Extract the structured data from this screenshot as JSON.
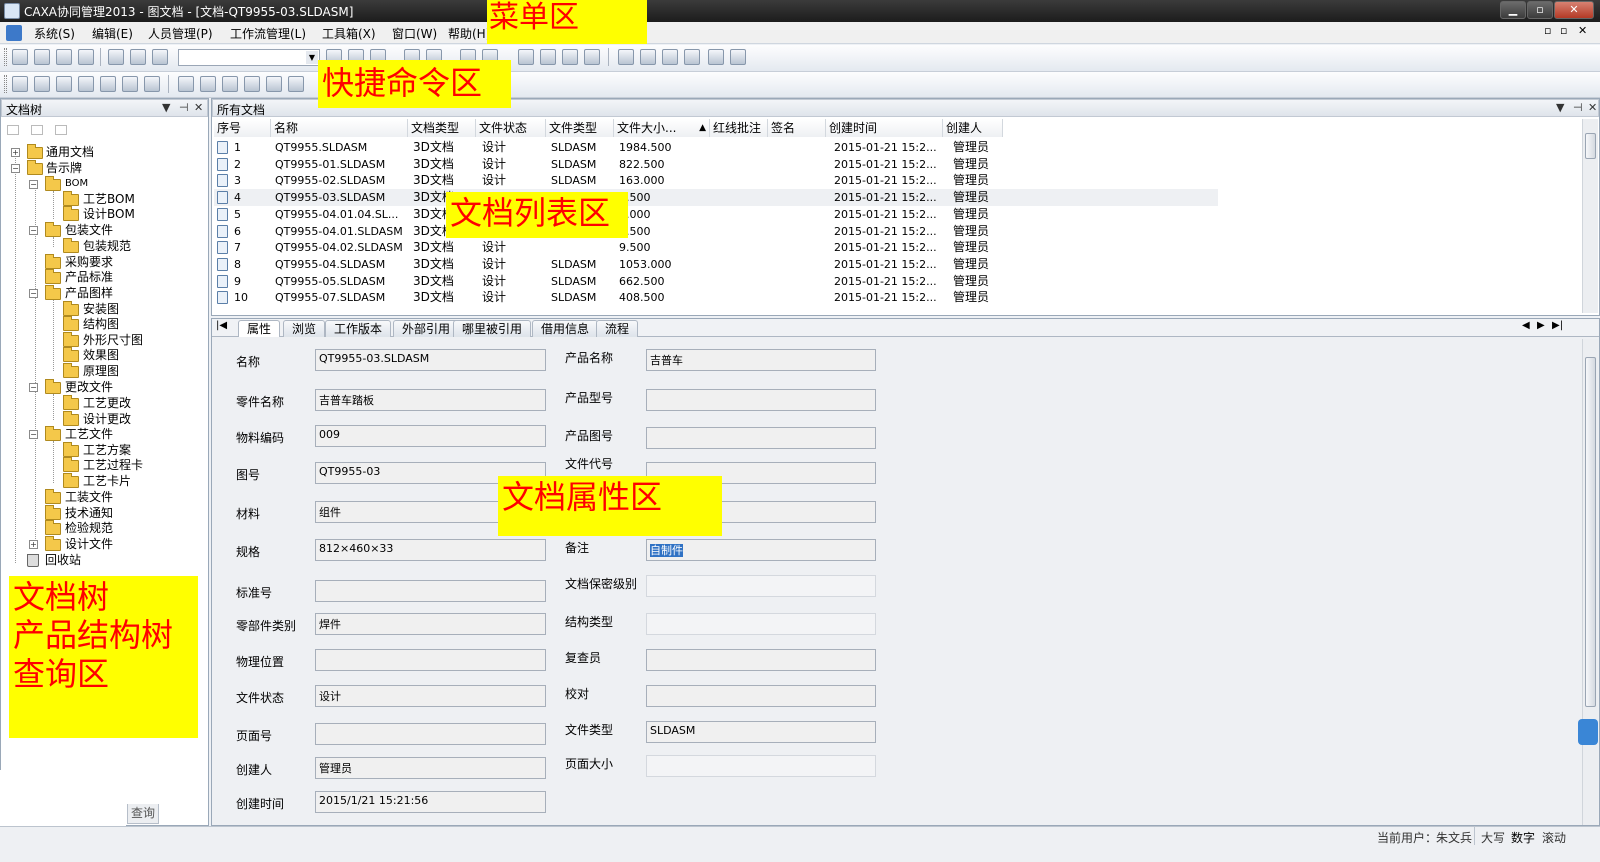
{
  "window": {
    "title": "CAXA协同管理2013 - 图文档 - [文档-QT9955-03.SLDASM]",
    "min": "▁",
    "max": "▫",
    "close": "✕"
  },
  "menu": {
    "items": [
      "系统(S)",
      "编辑(E)",
      "人员管理(P)",
      "工作流管理(L)",
      "工具箱(X)",
      "窗口(W)",
      "帮助(H)"
    ],
    "mdi": [
      "▫",
      "▫",
      "✕"
    ]
  },
  "callouts": {
    "menu": "菜单区",
    "toolbar": "快捷命令区",
    "list": "文档列表区",
    "props": "文档属性区",
    "tree_lines": [
      "文档树",
      "产品结构树",
      "查询区"
    ]
  },
  "tree": {
    "header": "文档树",
    "controls": [
      "▼",
      "⊣",
      "✕"
    ],
    "nodes": [
      "通用文档",
      "告示牌",
      "BOM",
      "工艺BOM",
      "设计BOM",
      "包装文件",
      "包装规范",
      "采购要求",
      "产品标准",
      "产品图样",
      "安装图",
      "结构图",
      "外形尺寸图",
      "效果图",
      "原理图",
      "更改文件",
      "工艺更改",
      "设计更改",
      "工艺文件",
      "工艺方案",
      "工艺过程卡",
      "工艺卡片",
      "工装文件",
      "技术通知",
      "检验规范",
      "设计文件",
      "回收站"
    ],
    "bottom_tab": "查询"
  },
  "list": {
    "header": "所有文档",
    "controls": [
      "▼",
      "⊣",
      "✕"
    ],
    "columns": [
      "序号",
      "名称",
      "文档类型",
      "文件状态",
      "文件类型",
      "文件大小...",
      "",
      "红线批注",
      "签名",
      "创建时间",
      "创建人"
    ],
    "sort_mark": "▲",
    "rows": [
      [
        "1",
        "QT9955.SLDASM",
        "3D文档",
        "设计",
        "SLDASM",
        "1984.500",
        "2015-01-21 15:2...",
        "管理员"
      ],
      [
        "2",
        "QT9955-01.SLDASM",
        "3D文档",
        "设计",
        "SLDASM",
        "822.500",
        "2015-01-21 15:2...",
        "管理员"
      ],
      [
        "3",
        "QT9955-02.SLDASM",
        "3D文档",
        "设计",
        "SLDASM",
        "163.000",
        "2015-01-21 15:2...",
        "管理员"
      ],
      [
        "4",
        "QT9955-03.SLDASM",
        "3D文档",
        "",
        "",
        "4.500",
        "2015-01-21 15:2...",
        "管理员"
      ],
      [
        "5",
        "QT9955-04.01.04.SL...",
        "3D文档",
        "",
        "",
        "9.000",
        "2015-01-21 15:2...",
        "管理员"
      ],
      [
        "6",
        "QT9955-04.01.SLDASM",
        "3D文档",
        "",
        "",
        "4.500",
        "2015-01-21 15:2...",
        "管理员"
      ],
      [
        "7",
        "QT9955-04.02.SLDASM",
        "3D文档",
        "设计",
        "",
        "9.500",
        "2015-01-21 15:2...",
        "管理员"
      ],
      [
        "8",
        "QT9955-04.SLDASM",
        "3D文档",
        "设计",
        "SLDASM",
        "1053.000",
        "2015-01-21 15:2...",
        "管理员"
      ],
      [
        "9",
        "QT9955-05.SLDASM",
        "3D文档",
        "设计",
        "SLDASM",
        "662.500",
        "2015-01-21 15:2...",
        "管理员"
      ],
      [
        "10",
        "QT9955-07.SLDASM",
        "3D文档",
        "设计",
        "SLDASM",
        "408.500",
        "2015-01-21 15:2...",
        "管理员"
      ]
    ]
  },
  "tabs": [
    "属性",
    "浏览",
    "工作版本",
    "外部引用",
    "哪里被引用",
    "借用信息",
    "流程"
  ],
  "tab_nav": [
    "|◀",
    "◀",
    "▶",
    "▶|"
  ],
  "props": {
    "left": [
      {
        "label": "名称",
        "value": "QT9955-03.SLDASM"
      },
      {
        "label": "零件名称",
        "value": "吉普车踏板"
      },
      {
        "label": "物料编码",
        "value": "009"
      },
      {
        "label": "图号",
        "value": "QT9955-03"
      },
      {
        "label": "材料",
        "value": "组件"
      },
      {
        "label": "规格",
        "value": "812×460×33"
      },
      {
        "label": "标准号",
        "value": ""
      },
      {
        "label": "零部件类别",
        "value": "焊件"
      },
      {
        "label": "物理位置",
        "value": ""
      },
      {
        "label": "文件状态",
        "value": "设计"
      },
      {
        "label": "页面号",
        "value": ""
      },
      {
        "label": "创建人",
        "value": "管理员"
      },
      {
        "label": "创建时间",
        "value": "2015/1/21 15:21:56"
      }
    ],
    "right": [
      {
        "label": "产品名称",
        "value": "吉普车"
      },
      {
        "label": "产品型号",
        "value": ""
      },
      {
        "label": "产品图号",
        "value": ""
      },
      {
        "label": "文件代号",
        "value": ""
      },
      {
        "label": "",
        "value": ""
      },
      {
        "label": "备注",
        "value": "自制件"
      },
      {
        "label": "文档保密级别",
        "value": ""
      },
      {
        "label": "结构类型",
        "value": ""
      },
      {
        "label": "复查员",
        "value": ""
      },
      {
        "label": "校对",
        "value": ""
      },
      {
        "label": "文件类型",
        "value": "SLDASM"
      },
      {
        "label": "页面大小",
        "value": ""
      }
    ]
  },
  "status": {
    "user_label": "当前用户：",
    "user": "朱文兵",
    "caps": "大写",
    "num": "数字",
    "scroll": "滚动"
  }
}
